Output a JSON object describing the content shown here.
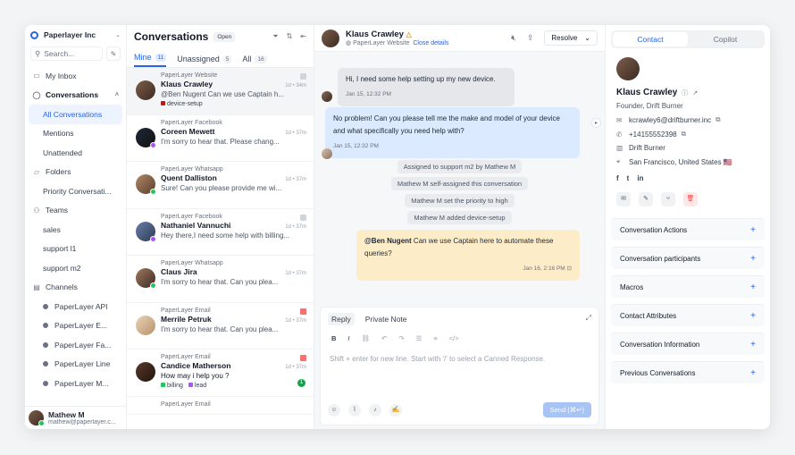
{
  "sidebar": {
    "org": "Paperlayer Inc",
    "search_placeholder": "Search...",
    "items": [
      {
        "label": "My Inbox"
      },
      {
        "label": "Conversations"
      },
      {
        "label": "All Conversations"
      },
      {
        "label": "Mentions"
      },
      {
        "label": "Unattended"
      },
      {
        "label": "Folders"
      },
      {
        "label": "Priority Conversati..."
      },
      {
        "label": "Teams"
      },
      {
        "label": "sales"
      },
      {
        "label": "support l1"
      },
      {
        "label": "support m2"
      },
      {
        "label": "Channels"
      },
      {
        "label": "PaperLayer API"
      },
      {
        "label": "PaperLayer E..."
      },
      {
        "label": "PaperLayer Fa..."
      },
      {
        "label": "PaperLayer Line"
      },
      {
        "label": "PaperLayer M..."
      }
    ],
    "user": {
      "name": "Mathew M",
      "email": "mathew@paperlayer.c..."
    }
  },
  "convlist": {
    "title": "Conversations",
    "status": "Open",
    "tabs": [
      {
        "label": "Mine",
        "count": "11"
      },
      {
        "label": "Unassigned",
        "count": "5"
      },
      {
        "label": "All",
        "count": "16"
      }
    ],
    "items": [
      {
        "inbox": "PaperLayer Website",
        "name": "Klaus Crawley",
        "msg": "@Ben Nugent Can we use Captain h...",
        "meta": "1d • 34m",
        "label": "device-setup"
      },
      {
        "inbox": "PaperLayer Facebook",
        "name": "Coreen Mewett",
        "msg": "I'm sorry to hear that. Please chang...",
        "meta": "1d • 37m"
      },
      {
        "inbox": "PaperLayer Whatsapp",
        "name": "Quent Dalliston",
        "msg": "Sure! Can you please provide me wi...",
        "meta": "1d • 37m"
      },
      {
        "inbox": "PaperLayer Facebook",
        "name": "Nathaniel Vannuchi",
        "msg": "Hey there,I need some help with billing...",
        "meta": "1d • 37m"
      },
      {
        "inbox": "PaperLayer Whatsapp",
        "name": "Claus Jira",
        "msg": "I'm sorry to hear that. Can you plea...",
        "meta": "1d • 37m"
      },
      {
        "inbox": "PaperLayer Email",
        "name": "Merrile Petruk",
        "msg": "I'm sorry to hear that. Can you plea...",
        "meta": "1d • 37m"
      },
      {
        "inbox": "PaperLayer Email",
        "name": "Candice Matherson",
        "msg": "How may i help you ?",
        "meta": "1d • 37m",
        "labels": [
          "billing",
          "lead"
        ],
        "unread": "1"
      },
      {
        "inbox": "PaperLayer Email",
        "name": "",
        "msg": "",
        "meta": ""
      }
    ]
  },
  "chat": {
    "contact_name": "Klaus Crawley",
    "inbox": "PaperLayer Website",
    "close_details": "Close details",
    "resolve": "Resolve",
    "messages": [
      {
        "text": "Hi, I need some help setting up my new device.",
        "time": "Jan 15, 12:32 PM"
      },
      {
        "text": "No problem! Can you please tell me the make and model of your device and what specifically you need help with?",
        "time": "Jan 15, 12:32 PM"
      }
    ],
    "activities": [
      "Assigned to support m2 by Mathew M",
      "Mathew M self-assigned this conversation",
      "Mathew M set the priority to high",
      "Mathew M added device-setup"
    ],
    "note": {
      "mention": "@Ben Nugent",
      "text": " Can we use Captain here to automate these queries?",
      "time": "Jan 16, 2:16 PM"
    },
    "composer": {
      "tab_reply": "Reply",
      "tab_note": "Private Note",
      "placeholder": "Shift + enter for new line. Start with '/' to select a Canned Response.",
      "send": "Send (⌘↵)"
    }
  },
  "contact": {
    "tabs": [
      "Contact",
      "Copilot"
    ],
    "name": "Klaus Crawley",
    "role": "Founder, Drift Burner",
    "email": "kcrawley6@driftburner.inc",
    "phone": "+14155552398",
    "company": "Drift Burner",
    "location": "San Francisco, United States 🇺🇸",
    "sections": [
      "Conversation Actions",
      "Conversation participants",
      "Macros",
      "Contact Attributes",
      "Conversation Information",
      "Previous Conversations"
    ]
  },
  "colors": {
    "accent": "#2563eb",
    "note_bg": "#fdecc8",
    "out_bubble": "#dbeafe"
  }
}
